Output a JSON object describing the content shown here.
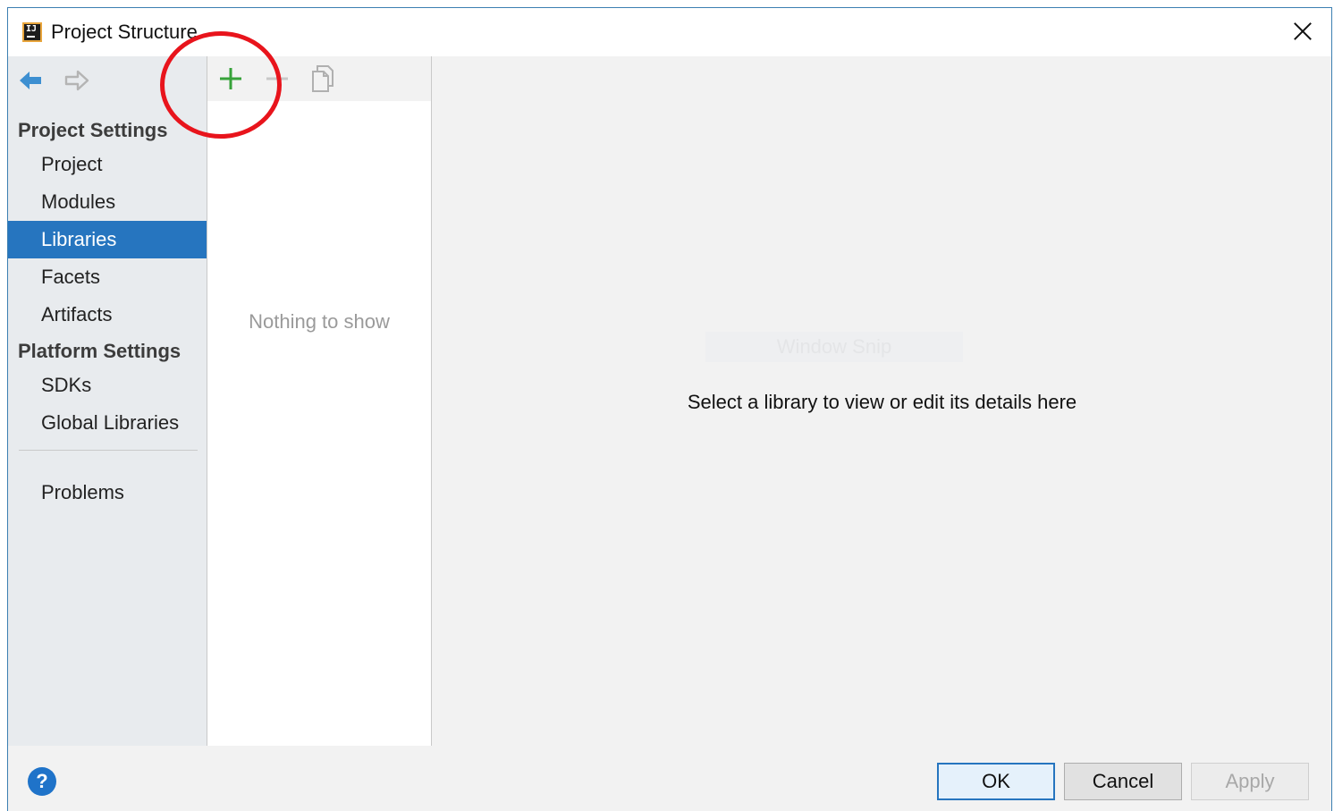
{
  "window": {
    "title": "Project Structure",
    "accent_color": "#2675bf",
    "highlight_color": "#e8141c"
  },
  "navigation": {
    "back_icon": "arrow-left-icon",
    "forward_icon": "arrow-right-icon"
  },
  "sidebar": {
    "project_settings_title": "Project Settings",
    "project_items": [
      {
        "label": "Project",
        "selected": false
      },
      {
        "label": "Modules",
        "selected": false
      },
      {
        "label": "Libraries",
        "selected": true
      },
      {
        "label": "Facets",
        "selected": false
      },
      {
        "label": "Artifacts",
        "selected": false
      }
    ],
    "platform_settings_title": "Platform Settings",
    "platform_items": [
      {
        "label": "SDKs",
        "selected": false
      },
      {
        "label": "Global Libraries",
        "selected": false
      }
    ],
    "problems_label": "Problems"
  },
  "list_panel": {
    "toolbar": {
      "add_icon": "plus-icon",
      "remove_icon": "minus-icon",
      "copy_icon": "copy-icon"
    },
    "empty_text": "Nothing to show"
  },
  "detail": {
    "ghost_text": "Window Snip",
    "message": "Select a library to view or edit its details here"
  },
  "footer": {
    "help_label": "?",
    "ok_label": "OK",
    "cancel_label": "Cancel",
    "apply_label": "Apply"
  }
}
